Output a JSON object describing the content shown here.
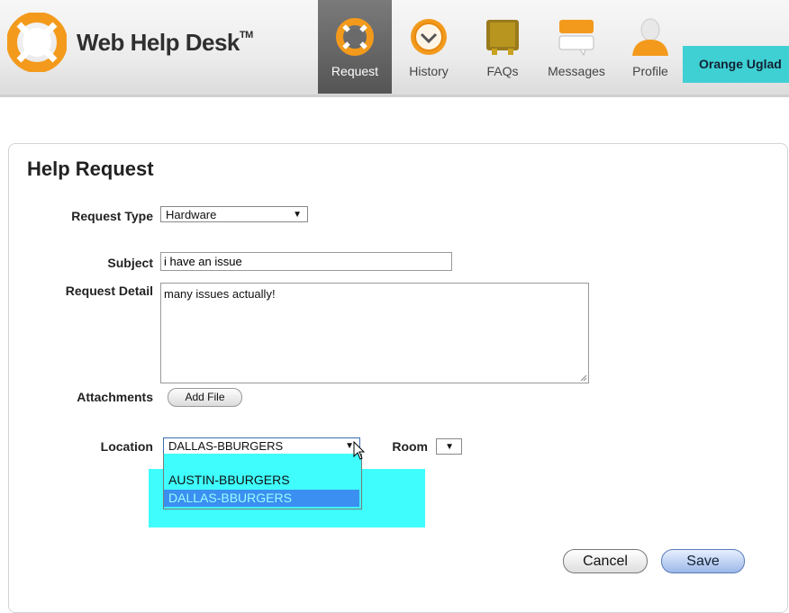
{
  "app": {
    "name": "Web Help Desk",
    "trademark": "TM"
  },
  "nav": [
    {
      "label": "Request",
      "icon": "lifebuoy-icon",
      "active": true
    },
    {
      "label": "History",
      "icon": "history-icon",
      "active": false
    },
    {
      "label": "FAQs",
      "icon": "faq-book-icon",
      "active": false
    },
    {
      "label": "Messages",
      "icon": "messages-icon",
      "active": false
    },
    {
      "label": "Profile",
      "icon": "profile-icon",
      "active": false
    }
  ],
  "user": {
    "name": "Orange Uglad"
  },
  "form": {
    "title": "Help Request",
    "request_type": {
      "label": "Request Type",
      "value": "Hardware"
    },
    "subject": {
      "label": "Subject",
      "value": "i have an issue"
    },
    "request_detail": {
      "label": "Request Detail",
      "value": "many issues actually!"
    },
    "attachments": {
      "label": "Attachments",
      "button": "Add File"
    },
    "location": {
      "label": "Location",
      "value": "DALLAS-BBURGERS",
      "options": [
        "AUSTIN-BBURGERS",
        "DALLAS-BBURGERS"
      ],
      "selected_index": 1
    },
    "room": {
      "label": "Room",
      "value": ""
    },
    "cancel_label": "Cancel",
    "save_label": "Save"
  },
  "colors": {
    "accent": "#3fd0d4",
    "highlight": "#3ffdfd",
    "selected_option": "#3b8ff0",
    "logo_orange": "#f39a1c"
  }
}
